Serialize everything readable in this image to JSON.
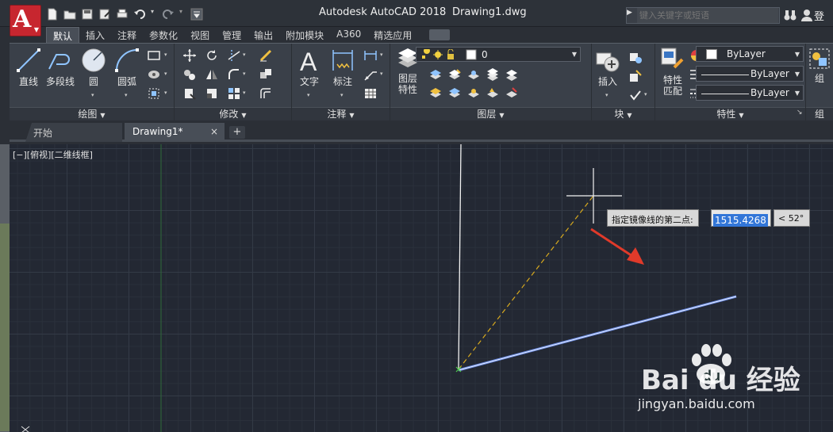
{
  "window": {
    "app_title": "Autodesk AutoCAD 2018",
    "file_name": "Drawing1.dwg",
    "app_button_letter": "A"
  },
  "search": {
    "placeholder": "键入关键字或短语"
  },
  "user": {
    "login_label": "登"
  },
  "ribbon_tabs": [
    "默认",
    "插入",
    "注释",
    "参数化",
    "视图",
    "管理",
    "输出",
    "附加模块",
    "A360",
    "精选应用"
  ],
  "active_ribbon_tab": "默认",
  "panels": {
    "draw": {
      "title": "绘图",
      "tools": {
        "line": "直线",
        "polyline": "多段线",
        "circle": "圆",
        "arc": "圆弧"
      }
    },
    "modify": {
      "title": "修改"
    },
    "annotation": {
      "title": "注释",
      "tools": {
        "text": "文字",
        "dimension": "标注"
      }
    },
    "layers": {
      "title": "图层",
      "layer_properties": "图层\n特性",
      "layer_properties_line1": "图层",
      "layer_properties_line2": "特性",
      "current_layer": "0"
    },
    "block": {
      "title": "块",
      "tools": {
        "insert": "插入"
      }
    },
    "properties": {
      "title": "特性",
      "match_line1": "特性",
      "match_line2": "匹配",
      "color": "ByLayer",
      "linetype": "ByLayer",
      "lineweight": "ByLayer"
    },
    "groups": {
      "title": "组",
      "tool": "组"
    }
  },
  "document_tabs": {
    "start": "开始",
    "drawing": "Drawing1*",
    "close_glyph": "×",
    "new_glyph": "+"
  },
  "viewport": {
    "label": "[−][俯视][二维线框]"
  },
  "dynamic_input": {
    "prompt": "指定镜像线的第二点:",
    "value": "1515.4268",
    "angle": "< 52°"
  },
  "watermark": {
    "brand": "Bai du 经验",
    "url": "jingyan.baidu.com"
  },
  "colors": {
    "canvas_bg": "#232833",
    "line_white": "#ffffff",
    "line_selected": "#9db8ff",
    "mirror_line": "#e0b020",
    "annotation_arrow": "#e03a2a"
  }
}
